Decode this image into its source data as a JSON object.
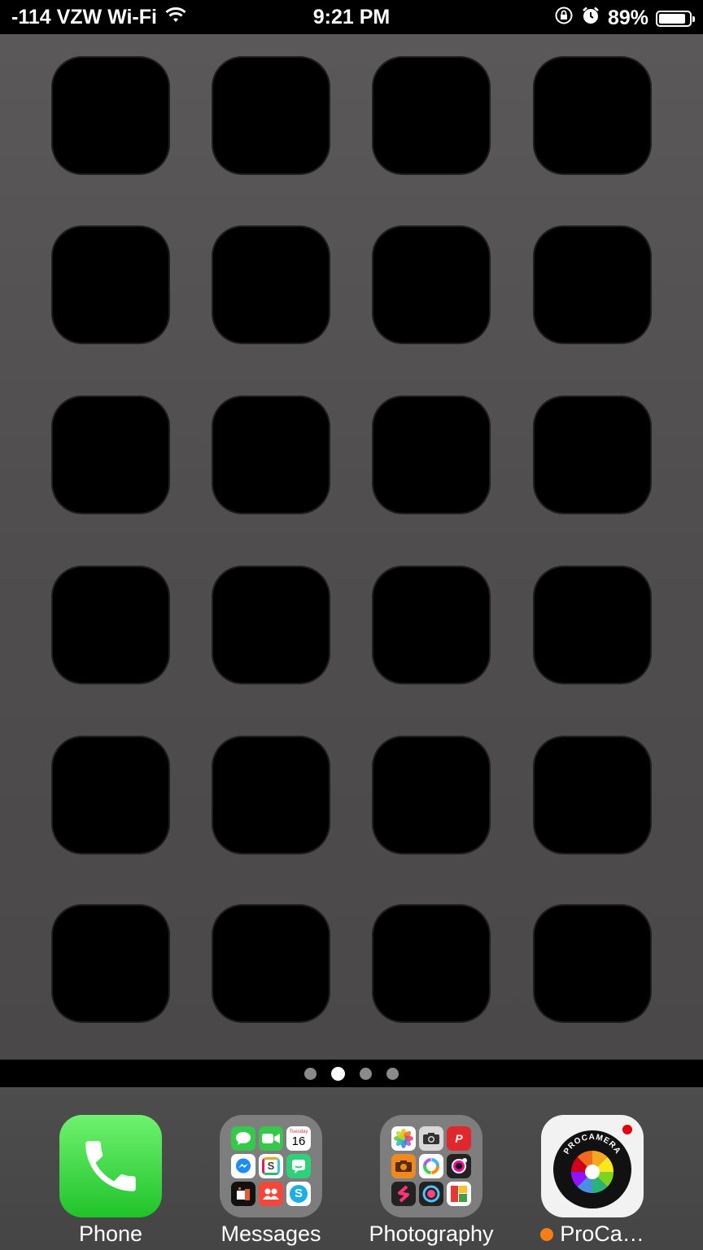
{
  "status_bar": {
    "carrier": "-114 VZW Wi-Fi",
    "time": "9:21 PM",
    "battery": "89%",
    "battery_level": 0.89,
    "icons": [
      "wifi-icon",
      "orientation-lock-icon",
      "alarm-icon",
      "battery-icon"
    ]
  },
  "page_indicator": {
    "count": 4,
    "active_index": 1
  },
  "dock": {
    "apps": [
      {
        "label": "Phone",
        "icon": "phone-icon"
      },
      {
        "label": "Messages",
        "icon": "messages-folder-icon"
      },
      {
        "label": "Photography",
        "icon": "photography-folder-icon"
      },
      {
        "label": "ProCa…",
        "icon": "procamera-icon",
        "badge": true,
        "recent_dot": true
      }
    ],
    "messages_folder_mini_text": {
      "calendar_day": "Tuesday",
      "calendar_date": "16",
      "skype_letter": "S",
      "slack_letter": "S"
    },
    "procamera_logo_text": "PROCAMERA",
    "photography_folder_mini_text": {
      "pdf_letter": "P"
    }
  },
  "colors": {
    "wallpaper": "#4f4d4d",
    "phone_green": "#20c32a",
    "badge_red": "#e0000e",
    "update_dot": "#f57d18"
  }
}
